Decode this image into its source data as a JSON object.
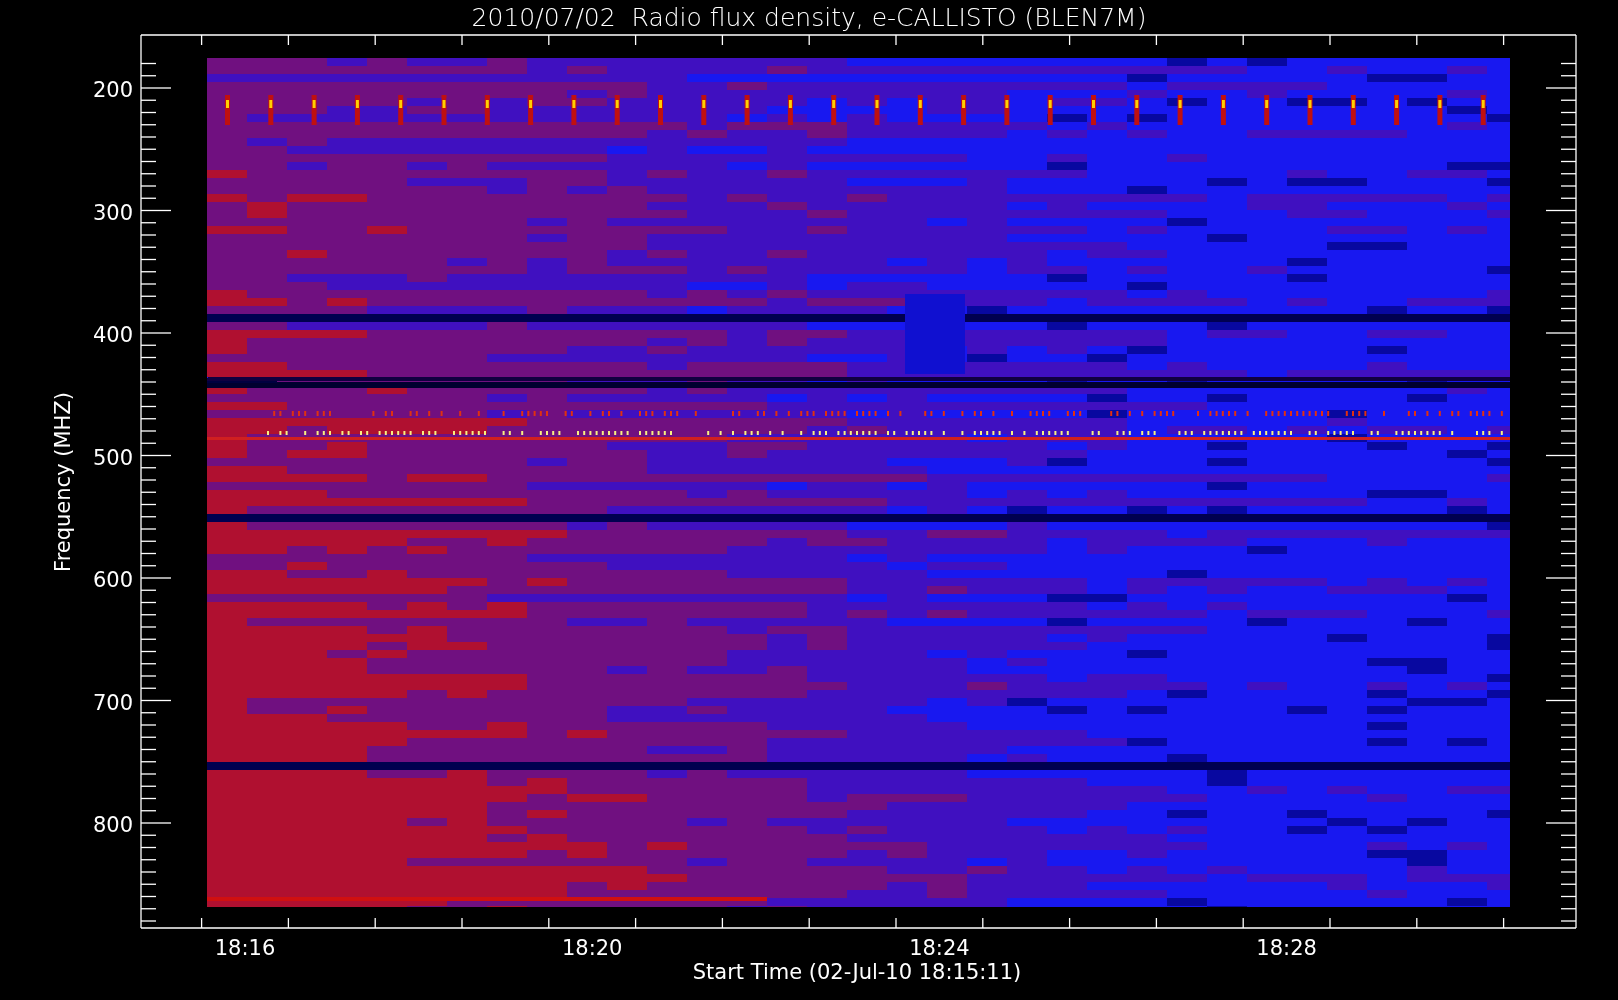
{
  "plot": {
    "title": "2010/07/02  Radio flux density, e-CALLISTO (BLEN7M)",
    "y_axis": {
      "label": "Frequency (MHZ)",
      "ticks": [
        "200",
        "300",
        "400",
        "500",
        "600",
        "700",
        "800"
      ]
    },
    "x_axis": {
      "label": "Start Time (02-Jul-10 18:15:11)",
      "ticks": [
        "18:16",
        "18:20",
        "18:24",
        "18:28"
      ]
    }
  }
}
